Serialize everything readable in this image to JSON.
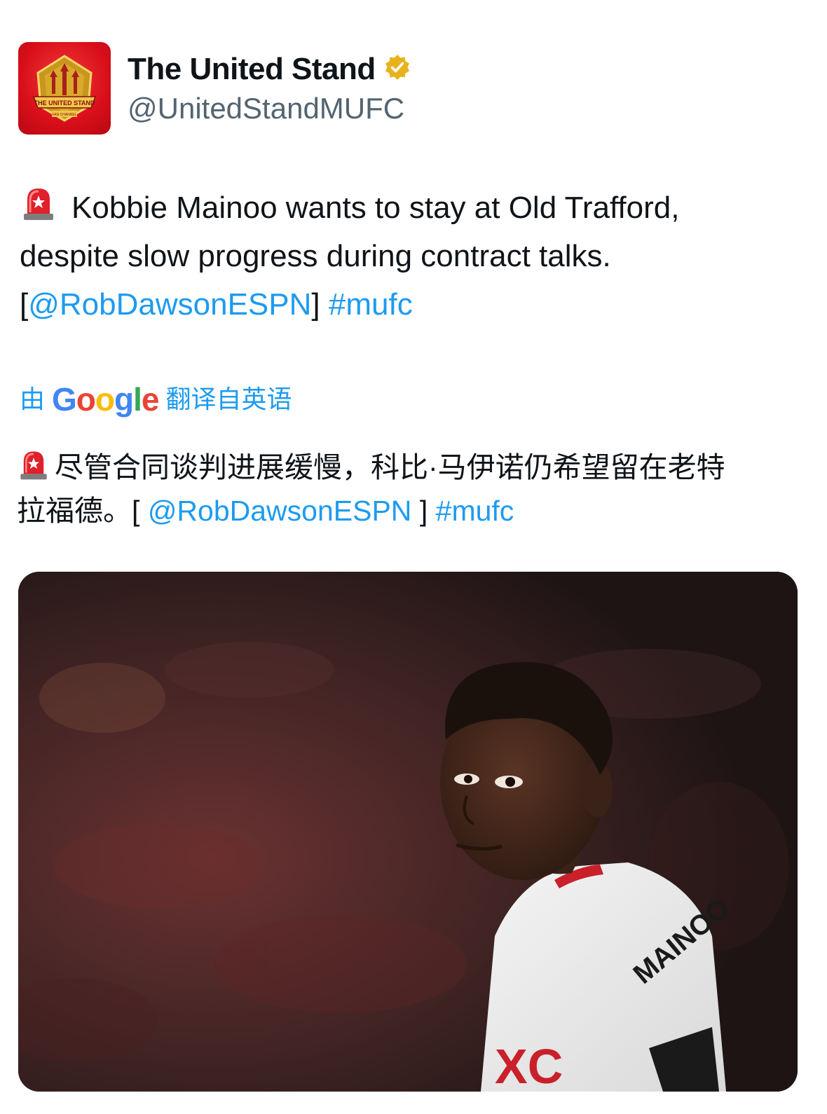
{
  "account": {
    "display_name": "The United Stand",
    "handle": "@UnitedStandMUFC",
    "verified_badge_icon": "gold-verified-badge-icon",
    "avatar_icon": "the-united-stand-logo-icon",
    "avatar_logo_text": "THE UNITED STAND",
    "avatar_logo_subtext": "FAN CHANNEL"
  },
  "tweet": {
    "emoji_icon": "police-light-emoji-icon",
    "line1": "Kobbie Mainoo wants to stay at Old Trafford,",
    "line2": "despite slow progress during contract talks.",
    "bracket_open": "[",
    "mention": "@RobDawsonESPN",
    "bracket_close": "]",
    "hashtag": "#mufc"
  },
  "translation": {
    "prefix": "由",
    "provider": "Google",
    "suffix": "翻译自英语",
    "line1": "尽管合同谈判进展缓慢，科比·马伊诺仍希望留在老特",
    "line2": "拉福德。[",
    "mention": "@RobDawsonESPN",
    "bracket_close": "]",
    "hashtag": "#mufc"
  },
  "media": {
    "photo_icon": "player-photo-image",
    "jersey_name": "MAINOO",
    "sponsor_text": "XC"
  },
  "colors": {
    "link": "#1d9bf0",
    "handle": "#536471",
    "text": "#0f1419",
    "avatar_red": "#d90f1a",
    "badge_gold": "#e8b21d"
  }
}
